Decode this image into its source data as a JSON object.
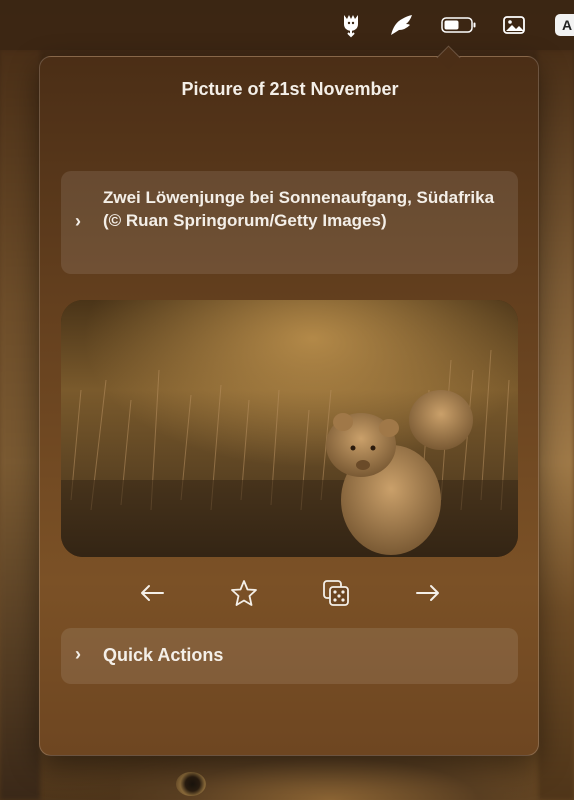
{
  "menubar": {
    "icons": [
      "alpaca-download-icon",
      "wing-icon",
      "battery-icon",
      "photo-icon"
    ],
    "partial_label": "A"
  },
  "popover": {
    "title": "Picture of 21st November",
    "description": "Zwei Löwenjunge bei Sonnenaufgang, Südafrika (© Ruan Springorum/Getty Images)",
    "nav": {
      "previous_icon": "arrow-left-icon",
      "favorite_icon": "star-icon",
      "random_icon": "dice-icon",
      "next_icon": "arrow-right-icon"
    },
    "quick_actions_label": "Quick Actions"
  },
  "colors": {
    "text": "#f4efe8",
    "panel_tint": "rgba(255,255,255,0.10)",
    "popover_bg": "#6a4420"
  }
}
